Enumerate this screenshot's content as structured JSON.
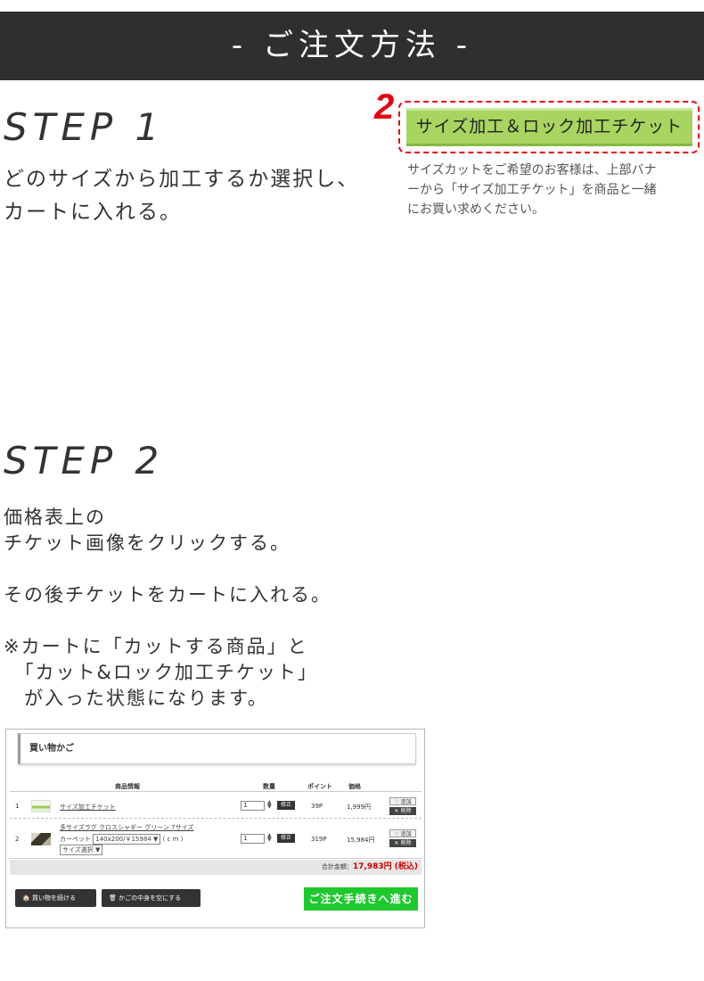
{
  "header": {
    "title": "- ご注文方法 -"
  },
  "step1": {
    "title": "STEP 1",
    "line1": "どのサイズから加工するか選択し、",
    "line2": "カートに入れる。"
  },
  "ticket": {
    "number": "2",
    "banner": "サイズ加工＆ロック加工チケット",
    "note_line1": "サイズカットをご希望のお客様は、上部バナ",
    "note_line2": "ーから「サイズ加工チケット」を商品と一緒",
    "note_line3": "にお買い求めください。"
  },
  "step2": {
    "title": "STEP 2",
    "line1": "価格表上の",
    "line2": "チケット画像をクリックする。",
    "line3": "その後チケットをカートに入れる。",
    "line4": "※カートに「カットする商品」と",
    "line5": "　「カット&ロック加工チケット」",
    "line6": "　が入った状態になります。"
  },
  "cart": {
    "heading": "買い物かご",
    "columns": {
      "product": "商品情報",
      "qty": "数量",
      "points": "ポイント",
      "price": "価格"
    },
    "rows": [
      {
        "index": "1",
        "name": "サイズ加工チケット",
        "qty": "1",
        "fix": "修正",
        "points": "39P",
        "price": "1,999円",
        "add": "♡ 追加",
        "delete": "✕ 削除"
      },
      {
        "index": "2",
        "name": "多サイズラグ クロスシャギー グリーン 7サイズ",
        "option_label": "カーペット",
        "option_value": "140x200/￥15984 ▼",
        "unit": "( c m )",
        "size_select": "サイズ選択 ▼",
        "qty": "1",
        "fix": "修正",
        "points": "319P",
        "price": "15,984円",
        "add": "♡ 追加",
        "delete": "✕ 削除"
      }
    ],
    "total_label": "合計金額：",
    "total_value": "17,983円 (税込)",
    "continue_button": "🏠 買い物を続ける",
    "empty_button": "🗑 かごの中身を空にする",
    "checkout_button": "ご注文手続きへ進む"
  }
}
